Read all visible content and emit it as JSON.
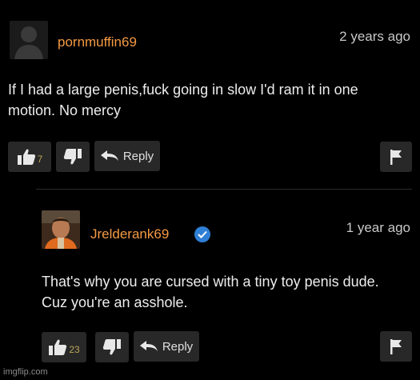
{
  "comments": [
    {
      "avatar_icon": "default-user-avatar-icon",
      "username": "pornmuffin69",
      "timestamp": "2 years ago",
      "text": "If I had a large penis,fuck going in slow I'd ram it in one motion. No mercy",
      "thumbs_up_count": "7",
      "reply_label": "Reply"
    },
    {
      "avatar_icon": "user-photo-avatar-icon",
      "username": "Jrelderank69",
      "verified": true,
      "timestamp": "1 year ago",
      "text": "That's why you are cursed with a tiny toy penis dude. Cuz you're an asshole.",
      "thumbs_up_count": "23",
      "reply_label": "Reply"
    }
  ],
  "watermark": "imgflip.com",
  "colors": {
    "background": "#000000",
    "username": "#f59a44",
    "button_bg": "#282828",
    "verified_badge": "#2f7fd6",
    "count": "#b9a35a"
  }
}
